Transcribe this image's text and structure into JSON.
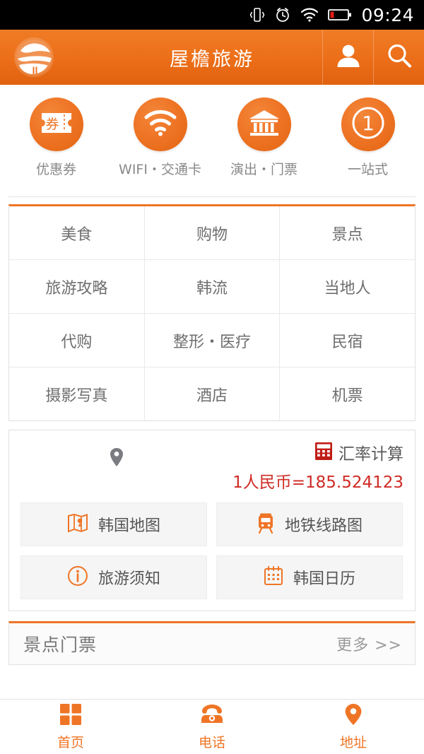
{
  "statusbar": {
    "time": "09:24",
    "icons": [
      "vibrate-icon",
      "alarm-icon",
      "wifi-icon",
      "battery-low-icon"
    ]
  },
  "header": {
    "title": "屋檐旅游",
    "logo": "globe-eave-logo",
    "account_icon": "person-icon",
    "search_icon": "search-icon"
  },
  "quick_actions": [
    {
      "label": "优惠券",
      "icon": "coupon-ticket-icon"
    },
    {
      "label": "WIFI・交通卡",
      "icon": "wifi-icon"
    },
    {
      "label": "演出・门票",
      "icon": "museum-building-icon"
    },
    {
      "label": "一站式",
      "icon": "number-one-circle-icon"
    }
  ],
  "categories": [
    [
      "美食",
      "购物",
      "景点"
    ],
    [
      "旅游攻略",
      "韩流",
      "当地人"
    ],
    [
      "代购",
      "整形・医疗",
      "民宿"
    ],
    [
      "摄影写真",
      "酒店",
      "机票"
    ]
  ],
  "tools": {
    "location_pin_icon": "map-pin-icon",
    "rate_title": "汇率计算",
    "rate_icon": "calculator-icon",
    "rate_value": "1人民币=185.524123",
    "rate_color": "#cf2b25",
    "buttons": [
      {
        "label": "韩国地图",
        "icon": "folded-map-icon"
      },
      {
        "label": "地铁线路图",
        "icon": "subway-train-icon"
      },
      {
        "label": "旅游须知",
        "icon": "info-circle-icon"
      },
      {
        "label": "韩国日历",
        "icon": "calendar-icon"
      }
    ]
  },
  "section": {
    "title": "景点门票",
    "more": "更多 >>"
  },
  "tabbar": [
    {
      "label": "首页",
      "icon": "grid-squares-icon"
    },
    {
      "label": "电话",
      "icon": "telephone-icon"
    },
    {
      "label": "地址",
      "icon": "map-pin-icon"
    }
  ],
  "theme": {
    "accent": "#ef7526",
    "accent_dark": "#e06210",
    "red": "#cf2b25",
    "status_bg": "#000000"
  }
}
